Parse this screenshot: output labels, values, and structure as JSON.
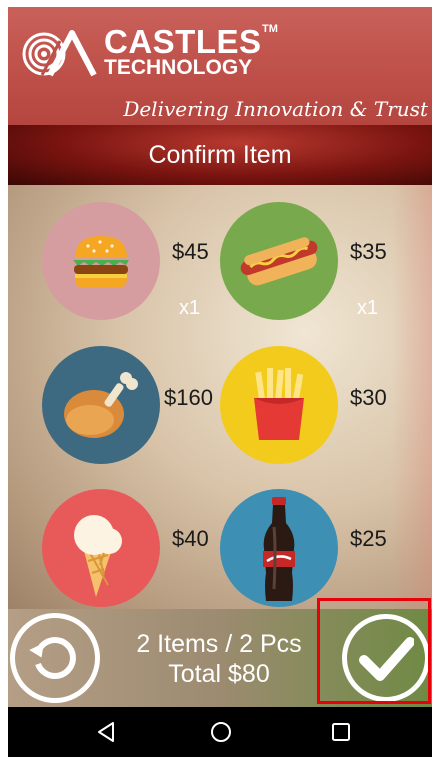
{
  "header": {
    "brand_name": "CASTLES",
    "brand_tm": "TM",
    "brand_sub": "TECHNOLOGY",
    "tagline": "Delivering Innovation & Trust"
  },
  "screen": {
    "title": "Confirm Item"
  },
  "items": [
    {
      "name": "burger",
      "icon": "burger-icon",
      "price": "$45",
      "qty": "x1",
      "bg": "#d69da0"
    },
    {
      "name": "hotdog",
      "icon": "hotdog-icon",
      "price": "$35",
      "qty": "x1",
      "bg": "#79a94d"
    },
    {
      "name": "chicken",
      "icon": "chicken-leg-icon",
      "price": "$160",
      "qty": "",
      "bg": "#3d6a80"
    },
    {
      "name": "fries",
      "icon": "fries-icon",
      "price": "$30",
      "qty": "",
      "bg": "#f2cb1c"
    },
    {
      "name": "ice-cream",
      "icon": "ice-cream-icon",
      "price": "$40",
      "qty": "",
      "bg": "#e85a5a"
    },
    {
      "name": "cola",
      "icon": "cola-bottle-icon",
      "price": "$25",
      "qty": "",
      "bg": "#3d8fb3"
    }
  ],
  "summary": {
    "items_line": "2 Items / 2 Pcs",
    "total_line": "Total $80"
  },
  "buttons": {
    "reset_icon": "reset-icon",
    "confirm_icon": "checkmark-icon"
  },
  "nav": {
    "back_icon": "back-triangle-icon",
    "home_icon": "home-circle-icon",
    "recents_icon": "recents-square-icon"
  },
  "colors": {
    "header": "#bd4f48",
    "title_bar": "#7a1410",
    "highlight": "#e8000b",
    "navbar": "#000000"
  }
}
